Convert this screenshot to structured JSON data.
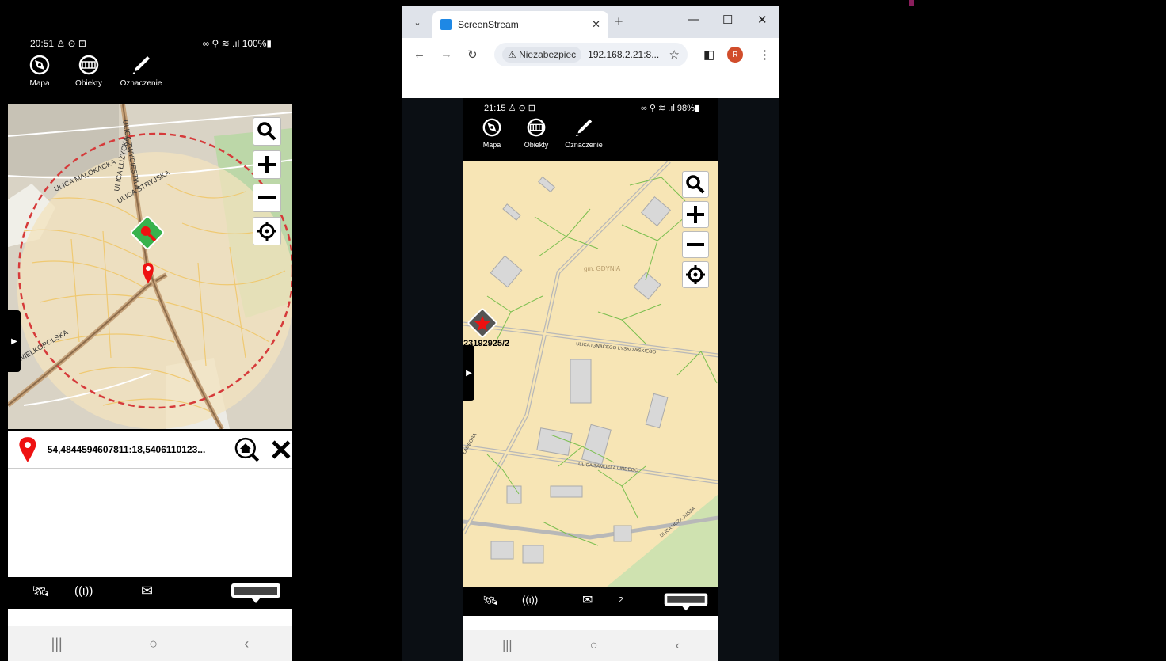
{
  "left_phone": {
    "status": {
      "time": "20:51",
      "left_icons": "♙ ⊙ ⊡",
      "right_icons": "∞ ⚲ ≋ .ıl",
      "battery": "100%"
    },
    "toolbar": {
      "map_label": "Mapa",
      "objects_label": "Obiekty",
      "marking_label": "Oznaczenie"
    },
    "map": {
      "streets": [
        "ULICA MAŁOKACKA",
        "ULICA STRYJSKA",
        "ULICA ŁUŻYCKA",
        "ULICA ZWYCIĘSTWA",
        "WIELKOPOLSKA"
      ]
    },
    "coords": "54,4844594607811:18,5406110123..."
  },
  "browser": {
    "tab_title": "ScreenStream",
    "omnibox_warning": "⚠ Niezabezpiec",
    "omnibox_url": "192.168.2.21:8...",
    "profile_initial": "R"
  },
  "right_phone": {
    "status": {
      "time": "21:15",
      "left_icons": "♙ ⊙ ⊡",
      "right_icons": "∞ ⚲ ≋ .ıl",
      "battery": "98%"
    },
    "toolbar": {
      "map_label": "Mapa",
      "objects_label": "Obiekty",
      "marking_label": "Oznaczenie"
    },
    "map": {
      "area_label": "gm. GDYNIA",
      "parcel_id": "23192925/2",
      "streets": [
        "ULICA IGNACEGO ŁYSKOWSKIEGO",
        "ULICA SAMUELA LINDEGO",
        "ULICA HOŻA JUSZA",
        "ŁAMBORA"
      ]
    },
    "message_count": "2"
  },
  "colors": {
    "map_bg": "#f7e5b5",
    "marker_red": "#e11",
    "key_green": "#37b24d",
    "circle": "#d63a3a"
  }
}
